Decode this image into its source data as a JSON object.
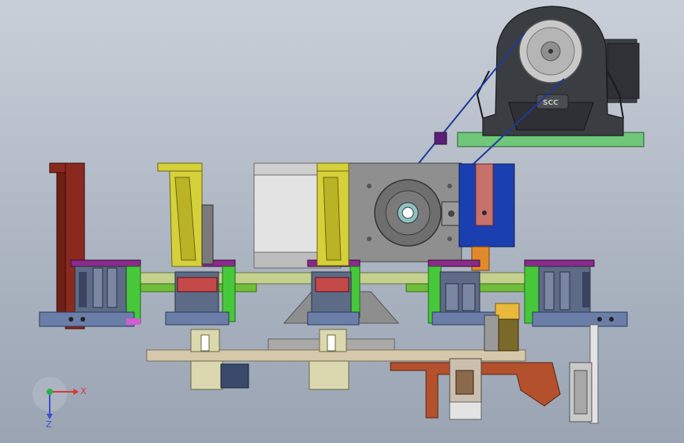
{
  "view": {
    "background_top": "#c9cfd8",
    "background_bottom": "#9aa4b3"
  },
  "triad": {
    "x_label": "X",
    "z_label": "Z",
    "x_color": "#d43a3a",
    "y_color": "#2bb24a",
    "z_color": "#3b4fd0"
  },
  "motor": {
    "brand_text": "SCC"
  },
  "colors": {
    "frame_red": "#8a2a1e",
    "yellow_arm": "#d6d13a",
    "green_rail": "#7fd65a",
    "purple_block": "#8a2a8a",
    "blue_plate": "#1a3fb0",
    "steel_light": "#d9d9d9",
    "steel_mid": "#a8a8a8",
    "steel_dark": "#5a5a5a",
    "tan_beam": "#cfc2a6",
    "rust_block": "#b4502c",
    "motor_body": "#3e4147",
    "base_green": "#6fc87a",
    "belt_line": "#1f3a9a"
  }
}
